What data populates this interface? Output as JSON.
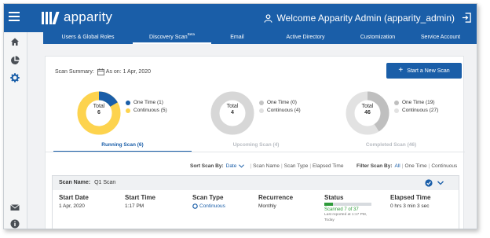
{
  "app": {
    "logo_text": "apparity",
    "welcome": "Welcome Apparity Admin (apparity_admin)"
  },
  "nav": {
    "tabs": [
      {
        "label": "Users & Global Roles"
      },
      {
        "label": "Discovery Scan",
        "badge": "Beta"
      },
      {
        "label": "Email"
      },
      {
        "label": "Active Directory"
      },
      {
        "label": "Customization"
      },
      {
        "label": "Service Account"
      }
    ]
  },
  "sidebar": {
    "icons": [
      "home-icon",
      "pie-chart-icon",
      "gear-icon",
      "mail-icon",
      "info-icon"
    ]
  },
  "summary": {
    "label": "Scan Summary:",
    "as_on": "As on: 1 Apr, 2020",
    "new_scan_label": "Start a New Scan"
  },
  "cards": [
    {
      "total_label": "Total",
      "total": "6",
      "one_time": "One Time (1)",
      "continuous": "Continuous (5)",
      "title": "Running Scan (6)"
    },
    {
      "total_label": "Total",
      "total": "4",
      "one_time": "One Time (0)",
      "continuous": "Continuous (4)",
      "title": "Upcoming Scan (4)"
    },
    {
      "total_label": "Total",
      "total": "46",
      "one_time": "One Time (19)",
      "continuous": "Continuous (27)",
      "title": "Completed Scan (46)"
    }
  ],
  "sort": {
    "label": "Sort Scan By:",
    "selected": "Date",
    "options": [
      "Scan Name",
      "Scan Type",
      "Elapsed Time"
    ],
    "filter_label": "Filter Scan By:",
    "filter_selected": "All",
    "filter_options": [
      "One Time",
      "Continuous"
    ]
  },
  "scan": {
    "name_label": "Scan Name:",
    "name": "Q1 Scan",
    "start_date_h": "Start Date",
    "start_date": "1 Apr, 2020",
    "start_time_h": "Start Time",
    "start_time": "1:17 PM",
    "scan_type_h": "Scan Type",
    "scan_type": "Continuous",
    "recurrence_h": "Recurrence",
    "recurrence": "Monthly",
    "status_h": "Status",
    "scanned": "Scanned 7 of 37",
    "progress_fraction": 0.19,
    "last_reported_1": "Last reported at 1:17 PM,",
    "last_reported_2": "Today",
    "elapsed_h": "Elapsed Time",
    "elapsed": "0 hrs 3 min 3 sec"
  },
  "colors": {
    "primary": "#1a5ea8",
    "one_time": "#1a5ea8",
    "continuous": "#fdd34e",
    "inactive": "#d7d7d7",
    "success": "#2e9b3a"
  }
}
